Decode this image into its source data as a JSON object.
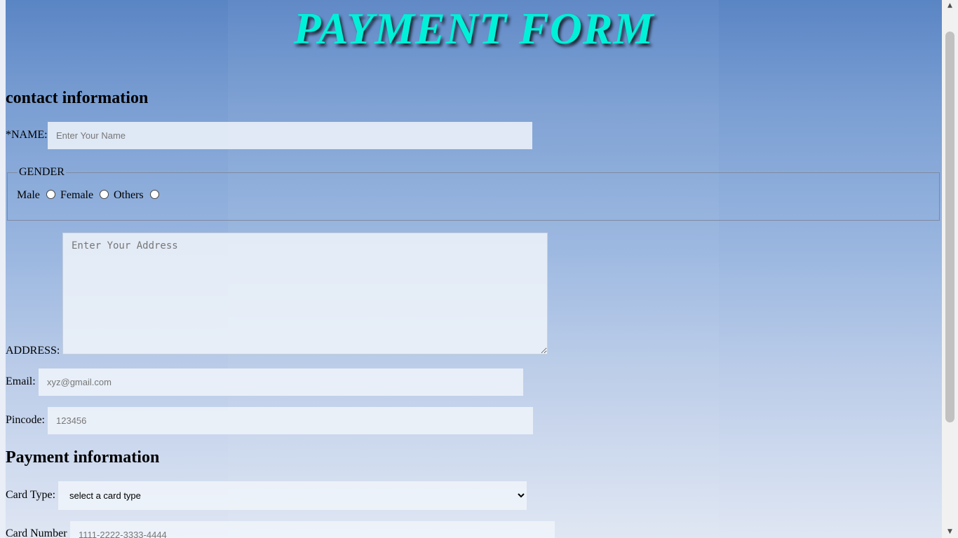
{
  "header": {
    "title": "PAYMENT FORM"
  },
  "contact": {
    "heading": "contact information",
    "name_label": "*NAME:",
    "name_placeholder": "Enter Your Name",
    "gender": {
      "legend": "GENDER",
      "options": [
        "Male",
        "Female",
        "Others"
      ]
    },
    "address_label": "ADDRESS:",
    "address_placeholder": "Enter Your Address",
    "email_label": "Email:",
    "email_placeholder": "xyz@gmail.com",
    "pincode_label": "Pincode:",
    "pincode_placeholder": "123456"
  },
  "payment": {
    "heading": "Payment information",
    "card_type_label": "Card Type:",
    "card_type_selected": "select a card type",
    "card_number_label": "Card Number",
    "card_number_placeholder": "1111-2222-3333-4444"
  },
  "colors": {
    "title": "#00f0d8",
    "background_top": "#5a85c4",
    "background_bottom": "#dfe6f3"
  }
}
